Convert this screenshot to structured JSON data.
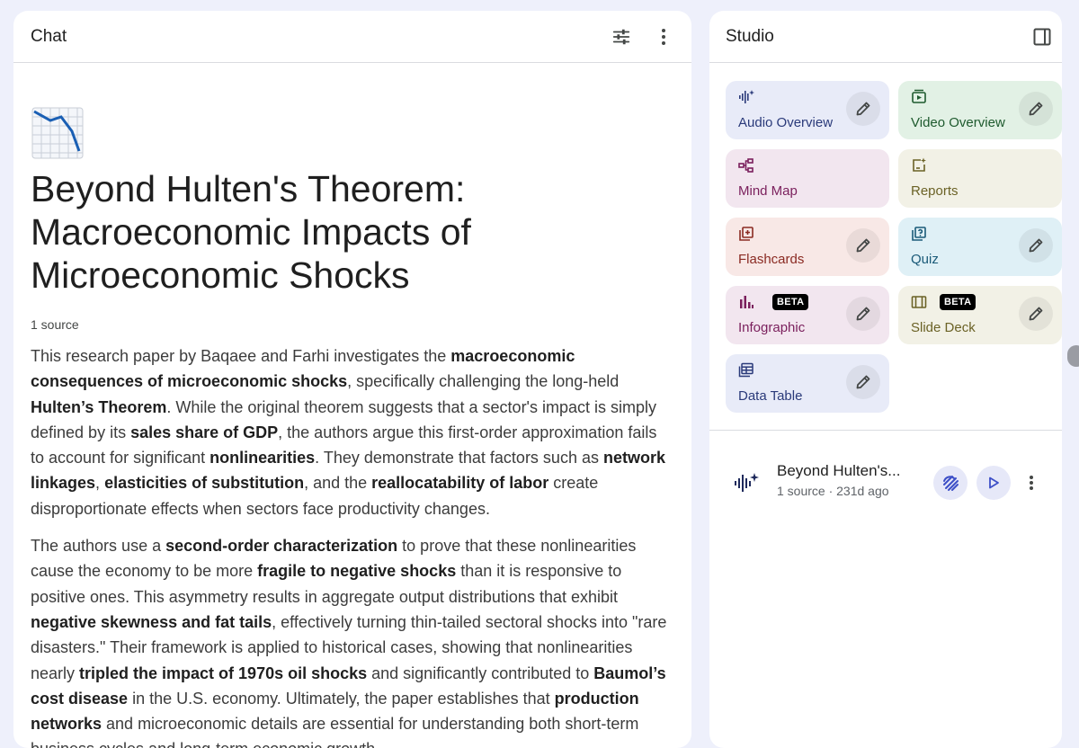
{
  "chat": {
    "title": "Chat",
    "doc_title": "Beyond Hulten's Theorem: Macroeconomic Impacts of Microeconomic Shocks",
    "emoji": "chart-decreasing-emoji",
    "source_count": "1 source",
    "summary_p1": [
      {
        "t": "This research paper by Baqaee and Farhi investigates the ",
        "b": false
      },
      {
        "t": "macroeconomic consequences of microeconomic shocks",
        "b": true
      },
      {
        "t": ", specifically challenging the long-held ",
        "b": false
      },
      {
        "t": "Hulten’s Theorem",
        "b": true
      },
      {
        "t": ". While the original theorem suggests that a sector's impact is simply defined by its ",
        "b": false
      },
      {
        "t": "sales share of GDP",
        "b": true
      },
      {
        "t": ", the authors argue this first-order approximation fails to account for significant ",
        "b": false
      },
      {
        "t": "nonlinearities",
        "b": true
      },
      {
        "t": ". They demonstrate that factors such as ",
        "b": false
      },
      {
        "t": "network linkages",
        "b": true
      },
      {
        "t": ", ",
        "b": false
      },
      {
        "t": "elasticities of substitution",
        "b": true
      },
      {
        "t": ", and the ",
        "b": false
      },
      {
        "t": "reallocatability of labor",
        "b": true
      },
      {
        "t": " create disproportionate effects when sectors face productivity changes.",
        "b": false
      }
    ],
    "summary_p2": [
      {
        "t": "The authors use a ",
        "b": false
      },
      {
        "t": "second-order characterization",
        "b": true
      },
      {
        "t": " to prove that these nonlinearities cause the economy to be more ",
        "b": false
      },
      {
        "t": "fragile to negative shocks",
        "b": true
      },
      {
        "t": " than it is responsive to positive ones. This asymmetry results in aggregate output distributions that exhibit ",
        "b": false
      },
      {
        "t": "negative skewness and fat tails",
        "b": true
      },
      {
        "t": ", effectively turning thin-tailed sectoral shocks into \"rare disasters.\" Their framework is applied to historical cases, showing that nonlinearities nearly ",
        "b": false
      },
      {
        "t": "tripled the impact of 1970s oil shocks",
        "b": true
      },
      {
        "t": " and significantly contributed to ",
        "b": false
      },
      {
        "t": "Baumol’s cost disease",
        "b": true
      },
      {
        "t": " in the U.S. economy. Ultimately, the paper establishes that ",
        "b": false
      },
      {
        "t": "production networks",
        "b": true
      },
      {
        "t": " and microeconomic details are essential for understanding both short-term business cycles and long-term economic growth.",
        "b": false
      }
    ]
  },
  "studio": {
    "title": "Studio",
    "tiles": [
      {
        "label": "Audio Overview",
        "icon": "audio-waveform-icon",
        "bg": "#e8ebf8",
        "fg": "#2a3a7a",
        "edit": true
      },
      {
        "label": "Video Overview",
        "icon": "video-icon",
        "bg": "#e2f1e5",
        "fg": "#1e5a2e",
        "edit": true
      },
      {
        "label": "Mind Map",
        "icon": "mind-map-icon",
        "bg": "#f2e6ef",
        "fg": "#7a1f5c",
        "edit": false
      },
      {
        "label": "Reports",
        "icon": "reports-icon",
        "bg": "#f2f1e6",
        "fg": "#6b6226",
        "edit": false
      },
      {
        "label": "Flashcards",
        "icon": "flashcards-icon",
        "bg": "#f8e8e6",
        "fg": "#8a2a22",
        "edit": true
      },
      {
        "label": "Quiz",
        "icon": "quiz-icon",
        "bg": "#dff0f6",
        "fg": "#1a5a78",
        "edit": true
      },
      {
        "label": "Infographic",
        "icon": "infographic-icon",
        "bg": "#f2e6ef",
        "fg": "#7a1f5c",
        "edit": true,
        "badge": "BETA"
      },
      {
        "label": "Slide Deck",
        "icon": "slide-deck-icon",
        "bg": "#f2f1e6",
        "fg": "#6b6226",
        "edit": true,
        "badge": "BETA"
      },
      {
        "label": "Data Table",
        "icon": "data-table-icon",
        "bg": "#e8ebf8",
        "fg": "#2a3a7a",
        "edit": true
      }
    ],
    "note": {
      "title": "Beyond Hulten's...",
      "meta": "1 source · 231d ago"
    }
  },
  "colors": {
    "page_bg": "#eef0fb",
    "accent": "#3d4fc7"
  }
}
